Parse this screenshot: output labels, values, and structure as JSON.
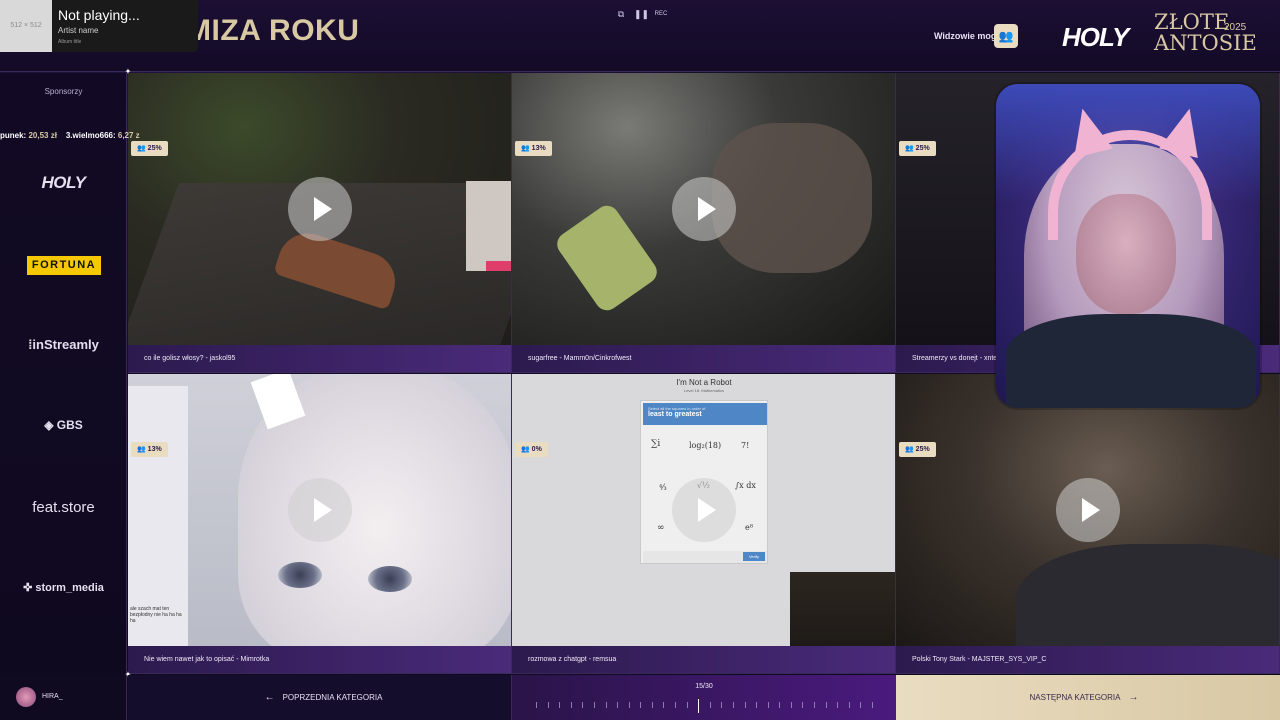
{
  "header": {
    "category_title": "MIZA ROKU",
    "viewers_label": "Widzowie mogą",
    "brand_holy": "HOLY",
    "brand_zlote": "ZŁOTE",
    "brand_antosie": "ANTOSIE",
    "brand_year": "2025",
    "media_controls": [
      "copy",
      "pause",
      "REC"
    ]
  },
  "now_playing": {
    "art_label": "512 × 512",
    "title": "Not playing...",
    "artist": "Artist name",
    "album": "Album title"
  },
  "sidebar": {
    "sponsors_label": "Sponsorzy",
    "ticker": {
      "donor1": "punek:",
      "amount1": "20,53 zł",
      "donor2": "3.wielmo666:",
      "amount2": "6,27 z"
    },
    "sponsors": [
      "HOLY",
      "FORTUNA",
      "inStreamly",
      "GBS",
      "feat.store",
      "storm_media"
    ]
  },
  "tiles": [
    {
      "badge": "25%",
      "caption": "co ile golisz włosy? - jaskol95"
    },
    {
      "badge": "13%",
      "caption": "sugarfree - Mamm0n/Cinkrofwest"
    },
    {
      "badge": "25%",
      "caption": "Streamerzy vs donejt - xnter"
    },
    {
      "badge": "13%",
      "caption": "Nie wiem nawet jak to opisać - Mimrotka"
    },
    {
      "badge": "0%",
      "caption": "rozmowa z chatgpt - remsua"
    },
    {
      "badge": "25%",
      "caption": "Polski Tony Stark - MAJSTER_SYS_VIP_C"
    }
  ],
  "robot_tile": {
    "title": "I'm Not a Robot",
    "subtitle": "Level 16: Mathematics",
    "instruction_small": "Select all the squares in order of",
    "instruction_big": "least to greatest",
    "button": "Verify"
  },
  "anime_tile": {
    "chat_text": "ale szach mat ten bezpłodny nie ha ha ha ha"
  },
  "footer": {
    "user_name": "HIRA_",
    "prev_label": "POPRZEDNIA KATEGORIA",
    "progress_label": "15/30",
    "progress_current": 15,
    "progress_total": 30,
    "next_label": "NASTĘPNA KATEGORIA"
  }
}
